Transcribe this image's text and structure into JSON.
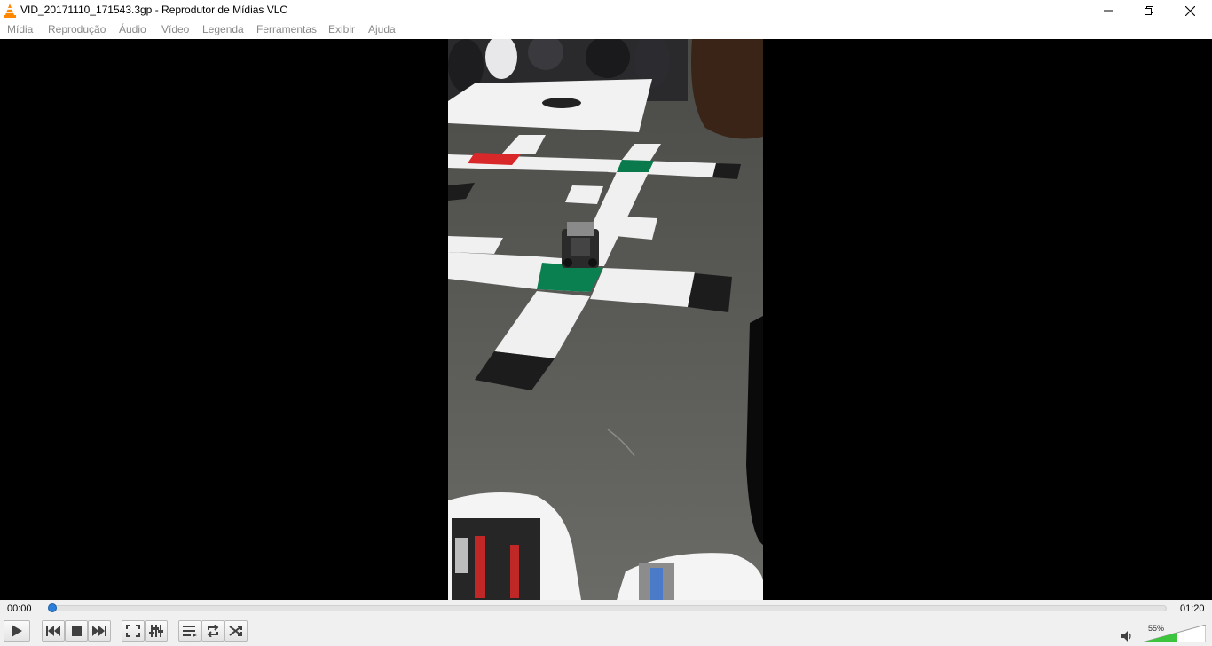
{
  "window": {
    "title": "VID_20171110_171543.3gp - Reprodutor de Mídias VLC",
    "minimize_icon": "minimize-icon",
    "maximize_icon": "restore-icon",
    "close_icon": "close-icon"
  },
  "menu": {
    "items": [
      {
        "label": "Mídia"
      },
      {
        "label": "Reprodução"
      },
      {
        "label": "Áudio"
      },
      {
        "label": "Vídeo"
      },
      {
        "label": "Legenda"
      },
      {
        "label": "Ferramentas"
      },
      {
        "label": "Exibir"
      },
      {
        "label": "Ajuda"
      }
    ]
  },
  "player": {
    "elapsed": "00:00",
    "total": "01:20",
    "progress_fraction": 0.004,
    "volume_label": "55%",
    "volume_fraction": 0.55
  },
  "colors": {
    "accent_blue": "#1e78d6",
    "volume_green": "#3cc43c",
    "vlc_orange": "#ff8800"
  },
  "controls": {
    "buttons": [
      {
        "name": "play-button",
        "icon": "play-icon"
      },
      {
        "name": "previous-button",
        "icon": "skip-previous-icon"
      },
      {
        "name": "stop-button",
        "icon": "stop-icon"
      },
      {
        "name": "next-button",
        "icon": "skip-next-icon"
      },
      {
        "name": "fullscreen-button",
        "icon": "fullscreen-icon"
      },
      {
        "name": "extended-settings-button",
        "icon": "equalizer-icon"
      },
      {
        "name": "playlist-button",
        "icon": "playlist-icon"
      },
      {
        "name": "loop-button",
        "icon": "loop-icon"
      },
      {
        "name": "shuffle-button",
        "icon": "shuffle-icon"
      }
    ]
  }
}
